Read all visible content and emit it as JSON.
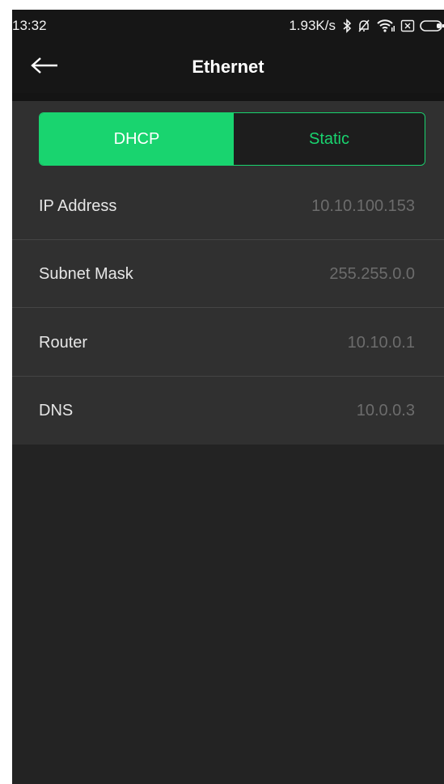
{
  "status_bar": {
    "time": "13:32",
    "speed": "1.93K/s",
    "icons": [
      "bluetooth-icon",
      "bell-off-icon",
      "wifi-icon",
      "sim-none-icon",
      "battery-icon"
    ]
  },
  "header": {
    "title": "Ethernet",
    "back_icon": "arrow-left-icon"
  },
  "mode_toggle": {
    "options": [
      "DHCP",
      "Static"
    ],
    "selected": "DHCP"
  },
  "settings": [
    {
      "label": "IP Address",
      "value": "10.10.100.153"
    },
    {
      "label": "Subnet Mask",
      "value": "255.255.0.0"
    },
    {
      "label": "Router",
      "value": "10.10.0.1"
    },
    {
      "label": "DNS",
      "value": "10.0.0.3"
    }
  ],
  "colors": {
    "accent": "#19d46f",
    "background": "#232323",
    "panel": "#303030",
    "bar": "#161616",
    "label_text": "#e6e6e6",
    "value_text": "#6c6c6c"
  }
}
